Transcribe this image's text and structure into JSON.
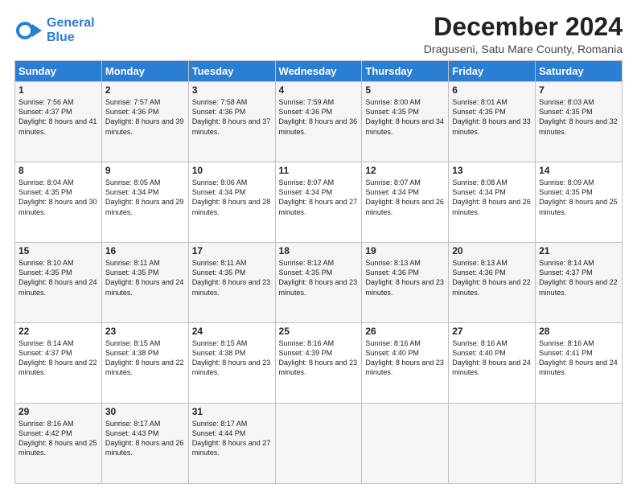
{
  "logo": {
    "line1": "General",
    "line2": "Blue"
  },
  "title": "December 2024",
  "location": "Draguseni, Satu Mare County, Romania",
  "header_days": [
    "Sunday",
    "Monday",
    "Tuesday",
    "Wednesday",
    "Thursday",
    "Friday",
    "Saturday"
  ],
  "weeks": [
    [
      {
        "day": "1",
        "sunrise": "Sunrise: 7:56 AM",
        "sunset": "Sunset: 4:37 PM",
        "daylight": "Daylight: 8 hours and 41 minutes."
      },
      {
        "day": "2",
        "sunrise": "Sunrise: 7:57 AM",
        "sunset": "Sunset: 4:36 PM",
        "daylight": "Daylight: 8 hours and 39 minutes."
      },
      {
        "day": "3",
        "sunrise": "Sunrise: 7:58 AM",
        "sunset": "Sunset: 4:36 PM",
        "daylight": "Daylight: 8 hours and 37 minutes."
      },
      {
        "day": "4",
        "sunrise": "Sunrise: 7:59 AM",
        "sunset": "Sunset: 4:36 PM",
        "daylight": "Daylight: 8 hours and 36 minutes."
      },
      {
        "day": "5",
        "sunrise": "Sunrise: 8:00 AM",
        "sunset": "Sunset: 4:35 PM",
        "daylight": "Daylight: 8 hours and 34 minutes."
      },
      {
        "day": "6",
        "sunrise": "Sunrise: 8:01 AM",
        "sunset": "Sunset: 4:35 PM",
        "daylight": "Daylight: 8 hours and 33 minutes."
      },
      {
        "day": "7",
        "sunrise": "Sunrise: 8:03 AM",
        "sunset": "Sunset: 4:35 PM",
        "daylight": "Daylight: 8 hours and 32 minutes."
      }
    ],
    [
      {
        "day": "8",
        "sunrise": "Sunrise: 8:04 AM",
        "sunset": "Sunset: 4:35 PM",
        "daylight": "Daylight: 8 hours and 30 minutes."
      },
      {
        "day": "9",
        "sunrise": "Sunrise: 8:05 AM",
        "sunset": "Sunset: 4:34 PM",
        "daylight": "Daylight: 8 hours and 29 minutes."
      },
      {
        "day": "10",
        "sunrise": "Sunrise: 8:06 AM",
        "sunset": "Sunset: 4:34 PM",
        "daylight": "Daylight: 8 hours and 28 minutes."
      },
      {
        "day": "11",
        "sunrise": "Sunrise: 8:07 AM",
        "sunset": "Sunset: 4:34 PM",
        "daylight": "Daylight: 8 hours and 27 minutes."
      },
      {
        "day": "12",
        "sunrise": "Sunrise: 8:07 AM",
        "sunset": "Sunset: 4:34 PM",
        "daylight": "Daylight: 8 hours and 26 minutes."
      },
      {
        "day": "13",
        "sunrise": "Sunrise: 8:08 AM",
        "sunset": "Sunset: 4:34 PM",
        "daylight": "Daylight: 8 hours and 26 minutes."
      },
      {
        "day": "14",
        "sunrise": "Sunrise: 8:09 AM",
        "sunset": "Sunset: 4:35 PM",
        "daylight": "Daylight: 8 hours and 25 minutes."
      }
    ],
    [
      {
        "day": "15",
        "sunrise": "Sunrise: 8:10 AM",
        "sunset": "Sunset: 4:35 PM",
        "daylight": "Daylight: 8 hours and 24 minutes."
      },
      {
        "day": "16",
        "sunrise": "Sunrise: 8:11 AM",
        "sunset": "Sunset: 4:35 PM",
        "daylight": "Daylight: 8 hours and 24 minutes."
      },
      {
        "day": "17",
        "sunrise": "Sunrise: 8:11 AM",
        "sunset": "Sunset: 4:35 PM",
        "daylight": "Daylight: 8 hours and 23 minutes."
      },
      {
        "day": "18",
        "sunrise": "Sunrise: 8:12 AM",
        "sunset": "Sunset: 4:35 PM",
        "daylight": "Daylight: 8 hours and 23 minutes."
      },
      {
        "day": "19",
        "sunrise": "Sunrise: 8:13 AM",
        "sunset": "Sunset: 4:36 PM",
        "daylight": "Daylight: 8 hours and 23 minutes."
      },
      {
        "day": "20",
        "sunrise": "Sunrise: 8:13 AM",
        "sunset": "Sunset: 4:36 PM",
        "daylight": "Daylight: 8 hours and 22 minutes."
      },
      {
        "day": "21",
        "sunrise": "Sunrise: 8:14 AM",
        "sunset": "Sunset: 4:37 PM",
        "daylight": "Daylight: 8 hours and 22 minutes."
      }
    ],
    [
      {
        "day": "22",
        "sunrise": "Sunrise: 8:14 AM",
        "sunset": "Sunset: 4:37 PM",
        "daylight": "Daylight: 8 hours and 22 minutes."
      },
      {
        "day": "23",
        "sunrise": "Sunrise: 8:15 AM",
        "sunset": "Sunset: 4:38 PM",
        "daylight": "Daylight: 8 hours and 22 minutes."
      },
      {
        "day": "24",
        "sunrise": "Sunrise: 8:15 AM",
        "sunset": "Sunset: 4:38 PM",
        "daylight": "Daylight: 8 hours and 23 minutes."
      },
      {
        "day": "25",
        "sunrise": "Sunrise: 8:16 AM",
        "sunset": "Sunset: 4:39 PM",
        "daylight": "Daylight: 8 hours and 23 minutes."
      },
      {
        "day": "26",
        "sunrise": "Sunrise: 8:16 AM",
        "sunset": "Sunset: 4:40 PM",
        "daylight": "Daylight: 8 hours and 23 minutes."
      },
      {
        "day": "27",
        "sunrise": "Sunrise: 8:16 AM",
        "sunset": "Sunset: 4:40 PM",
        "daylight": "Daylight: 8 hours and 24 minutes."
      },
      {
        "day": "28",
        "sunrise": "Sunrise: 8:16 AM",
        "sunset": "Sunset: 4:41 PM",
        "daylight": "Daylight: 8 hours and 24 minutes."
      }
    ],
    [
      {
        "day": "29",
        "sunrise": "Sunrise: 8:16 AM",
        "sunset": "Sunset: 4:42 PM",
        "daylight": "Daylight: 8 hours and 25 minutes."
      },
      {
        "day": "30",
        "sunrise": "Sunrise: 8:17 AM",
        "sunset": "Sunset: 4:43 PM",
        "daylight": "Daylight: 8 hours and 26 minutes."
      },
      {
        "day": "31",
        "sunrise": "Sunrise: 8:17 AM",
        "sunset": "Sunset: 4:44 PM",
        "daylight": "Daylight: 8 hours and 27 minutes."
      },
      null,
      null,
      null,
      null
    ]
  ]
}
